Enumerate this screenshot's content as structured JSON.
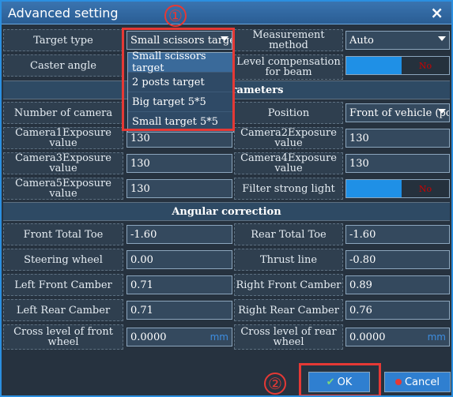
{
  "dialog": {
    "title": "Advanced setting",
    "close_label": "×"
  },
  "rows": {
    "target_type_label": "Target type",
    "target_type_value": "Small scissors target",
    "measurement_method_label": "Measurement method",
    "measurement_method_value": "Auto",
    "caster_angle_label": "Caster angle",
    "level_comp_label": "Level compensation for beam",
    "level_comp_state": "No",
    "number_of_camera_label": "Number of camera",
    "position_label": "Position",
    "position_value": "Front of vehicle (post",
    "cam1_label": "Camera1Exposure value",
    "cam1_value": "130",
    "cam2_label": "Camera2Exposure value",
    "cam2_value": "130",
    "cam3_label": "Camera3Exposure value",
    "cam3_value": "130",
    "cam4_label": "Camera4Exposure value",
    "cam4_value": "130",
    "cam5_label": "Camera5Exposure value",
    "cam5_value": "130",
    "filter_label": "Filter strong light",
    "filter_state": "No"
  },
  "sections": {
    "camera_parameters": "Camera parameters",
    "angular_correction": "Angular correction"
  },
  "angular": {
    "front_total_toe_label": "Front Total Toe",
    "front_total_toe_value": "-1.60",
    "rear_total_toe_label": "Rear Total Toe",
    "rear_total_toe_value": "-1.60",
    "steering_wheel_label": "Steering wheel",
    "steering_wheel_value": "0.00",
    "thrust_line_label": "Thrust line",
    "thrust_line_value": "-0.80",
    "left_front_camber_label": "Left Front Camber",
    "left_front_camber_value": "0.71",
    "right_front_camber_label": "Right Front Camber",
    "right_front_camber_value": "0.89",
    "left_rear_camber_label": "Left Rear Camber",
    "left_rear_camber_value": "0.71",
    "right_rear_camber_label": "Right Rear Camber",
    "right_rear_camber_value": "0.76",
    "cross_front_label": "Cross level of front wheel",
    "cross_front_value": "0.0000",
    "cross_rear_label": "Cross level of rear wheel",
    "cross_rear_value": "0.0000",
    "unit_mm": "mm"
  },
  "dropdown": {
    "options": [
      "Small scissors target",
      "2 posts target",
      "Big target 5*5",
      "Small target 5*5"
    ]
  },
  "footer": {
    "ok_label": "OK",
    "cancel_label": "Cancel"
  },
  "callouts": {
    "one": "①",
    "two": "②"
  },
  "colors": {
    "accent": "#2b8fe0",
    "callout": "#e53935",
    "toggle_on": "#1f90e6"
  }
}
